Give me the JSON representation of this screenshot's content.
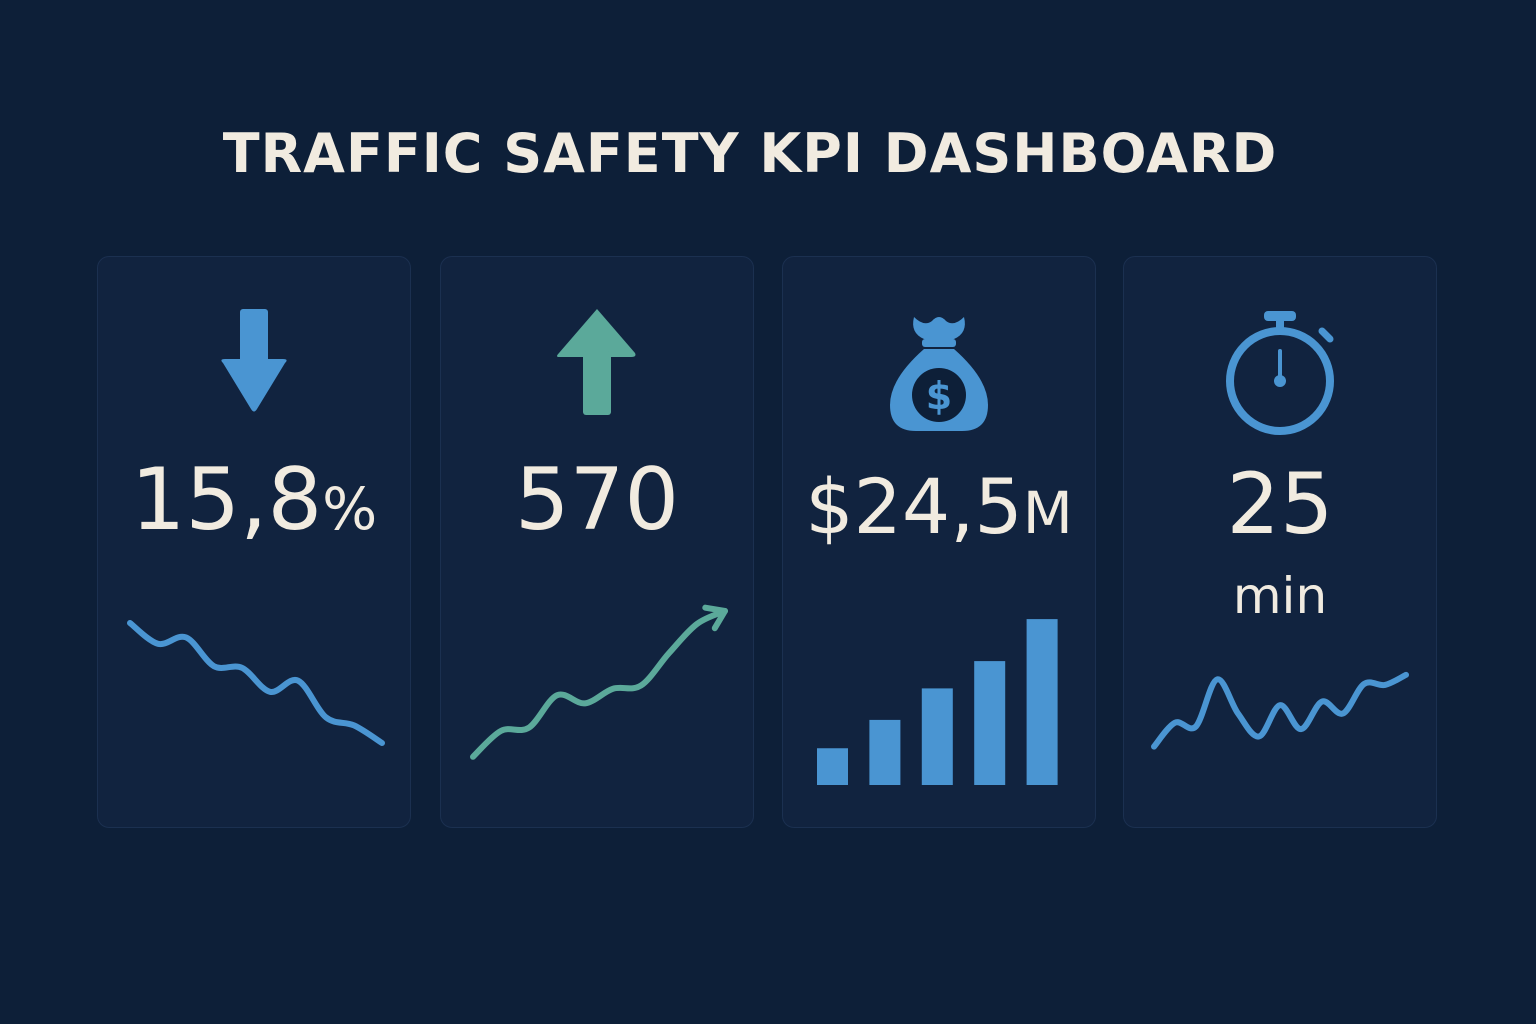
{
  "header": {
    "title": "TRAFFIC SAFETY KPI DASHBOARD"
  },
  "cards": [
    {
      "icon": "arrow-down-icon",
      "value": "15,8",
      "unit": "%",
      "color": "#4a95d2"
    },
    {
      "icon": "arrow-up-icon",
      "value": "570",
      "color": "#5ba99a"
    },
    {
      "icon": "money-bag-icon",
      "value": "$24,5",
      "unit": "M",
      "color": "#4a95d2"
    },
    {
      "icon": "stopwatch-icon",
      "value": "25",
      "unit_line": "min",
      "color": "#4a95d2"
    }
  ],
  "chart_data": [
    {
      "type": "line",
      "series": [
        {
          "values": [
            9.5,
            8.2,
            8.6,
            6.8,
            6.7,
            5.2,
            5.9,
            3.6,
            3.1,
            2.0
          ]
        }
      ],
      "ylim": [
        0,
        10
      ],
      "grid": false,
      "color": "#4a95d2"
    },
    {
      "type": "line",
      "series": [
        {
          "values": [
            1.0,
            2.6,
            2.8,
            4.8,
            4.3,
            5.2,
            5.4,
            7.4,
            9.2,
            10.0
          ]
        }
      ],
      "ylim": [
        0,
        10
      ],
      "grid": false,
      "end_arrow": true,
      "color": "#5ba99a"
    },
    {
      "type": "bar",
      "values": [
        3.5,
        6.2,
        9.2,
        11.8,
        15.8
      ],
      "ylim": [
        0,
        16
      ],
      "grid": false,
      "color": "#4a95d2"
    },
    {
      "type": "line",
      "series": [
        {
          "values": [
            2.0,
            4.6,
            4.2,
            9.3,
            5.6,
            3.1,
            6.5,
            3.9,
            6.9,
            5.6,
            8.8,
            8.7,
            9.8
          ]
        }
      ],
      "ylim": [
        0,
        10
      ],
      "grid": false,
      "color": "#4a95d2"
    }
  ]
}
